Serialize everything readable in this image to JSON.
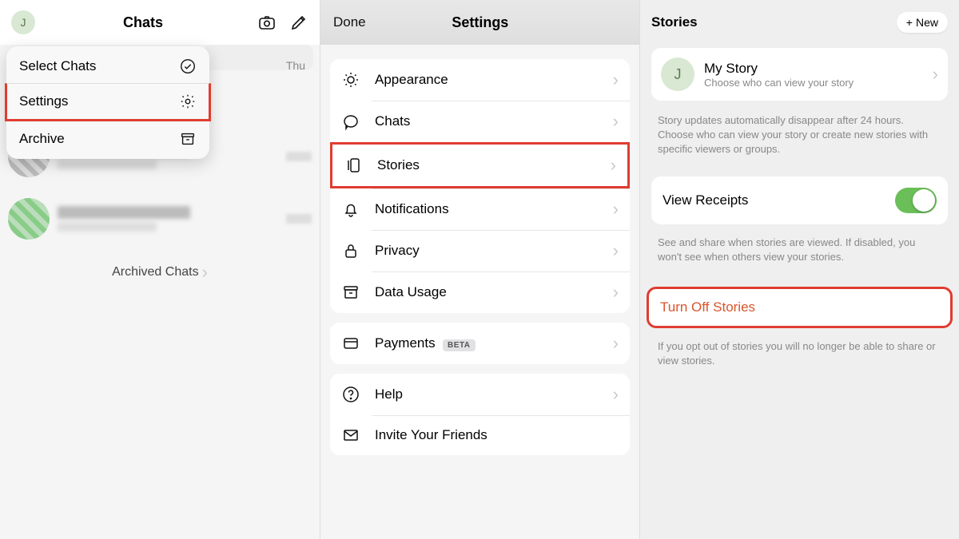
{
  "pane1": {
    "avatar_initial": "J",
    "title": "Chats",
    "menu": {
      "select": "Select Chats",
      "settings": "Settings",
      "archive": "Archive"
    },
    "time_thu": "Thu",
    "archived": "Archived Chats"
  },
  "pane2": {
    "done": "Done",
    "title": "Settings",
    "items": {
      "appearance": "Appearance",
      "chats": "Chats",
      "stories": "Stories",
      "notifications": "Notifications",
      "privacy": "Privacy",
      "data": "Data Usage",
      "payments": "Payments",
      "payments_badge": "BETA",
      "help": "Help",
      "invite": "Invite Your Friends"
    }
  },
  "pane3": {
    "title": "Stories",
    "new_btn": "New",
    "mystory": {
      "title": "My Story",
      "sub": "Choose who can view your story"
    },
    "helper1": "Story updates automatically disappear after 24 hours. Choose who can view your story or create new stories with specific viewers or groups.",
    "view_receipts": "View Receipts",
    "helper2": "See and share when stories are viewed. If disabled, you won't see when others view your stories.",
    "turn_off": "Turn Off Stories",
    "helper3": "If you opt out of stories you will no longer be able to share or view stories."
  }
}
